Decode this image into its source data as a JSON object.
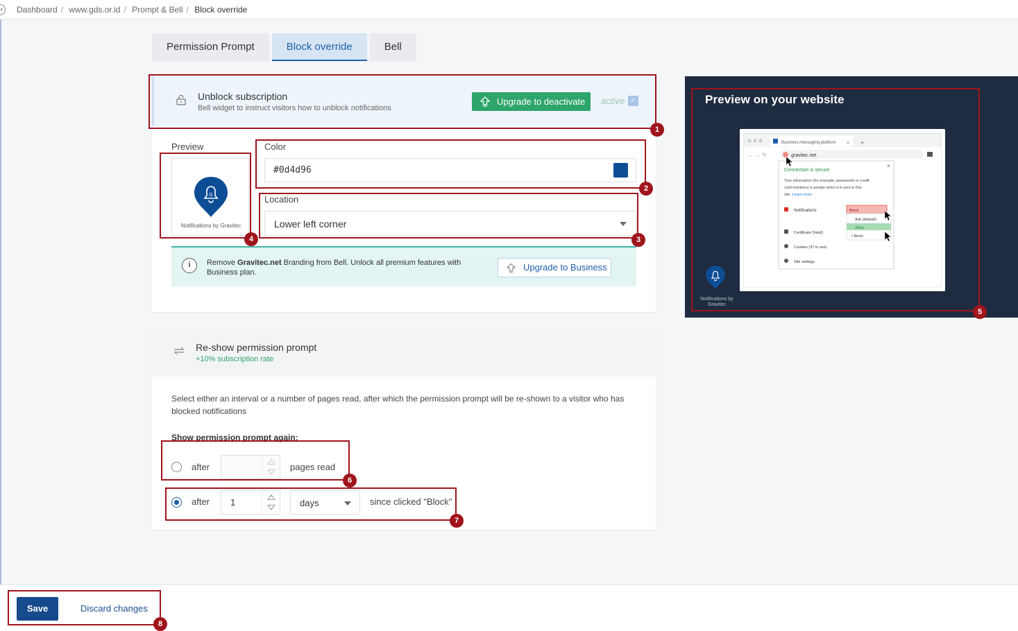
{
  "breadcrumb": [
    "Dashboard",
    "www.gds.or.id",
    "Prompt & Bell",
    "Block override"
  ],
  "tabs": [
    {
      "label": "Permission Prompt",
      "active": false
    },
    {
      "label": "Block override",
      "active": true
    },
    {
      "label": "Bell",
      "active": false
    }
  ],
  "unblock": {
    "title": "Unblock subscription",
    "subtitle": "Bell widget to instruct visitors how to unblock notifications",
    "upgrade_label": "Upgrade to deactivate",
    "active_label": "active",
    "active_checked": true,
    "preview_label": "Preview",
    "preview_caption": "Notifications by Gravitec",
    "color_label": "Color",
    "color_value": "#0d4d96",
    "location_label": "Location",
    "location_value": "Lower left corner",
    "promo": {
      "prefix": "Remove ",
      "brand": "Gravitec.net",
      "suffix": " Branding from Bell. Unlock all premium features with Business plan.",
      "button_label": "Upgrade to Business"
    }
  },
  "reshow": {
    "title": "Re-show permission prompt",
    "rate": "+10% subscription rate",
    "description": "Select either an interval or a number of pages read, after which the permission prompt will be re-shown to a visitor who has blocked notifications",
    "again_label": "Show permission prompt again:",
    "option_pages": {
      "selected": false,
      "prefix": "after",
      "value": "",
      "suffix": "pages read"
    },
    "option_days": {
      "selected": true,
      "prefix": "after",
      "value": "1",
      "unit": "days",
      "suffix": "since clicked \"Block\""
    }
  },
  "preview_panel": {
    "title": "Preview on your website",
    "caption": "Notifications by Gravitec",
    "browser": {
      "tab_title": "Business messaging platform",
      "url": "gravitec.net",
      "secure_title": "Connection is secure",
      "secure_text": "Your information (for example, passwords or credit card numbers) is private when it is sent to this site.",
      "learn_more": "Learn more",
      "notifications_label": "Notifications",
      "notifications_value": "Block",
      "options": [
        "Ask (default)",
        "Allow",
        "Block"
      ],
      "certificate": "Certificate (Valid)",
      "cookies": "Cookies (37 in use)",
      "site_settings": "Site settings"
    }
  },
  "footer": {
    "save_label": "Save",
    "discard_label": "Discard changes"
  },
  "callouts": [
    "1",
    "2",
    "3",
    "4",
    "5",
    "6",
    "7",
    "8"
  ],
  "colors": {
    "accent": "#1e5faa",
    "brand_blue": "#0d4d96",
    "success": "#2ea56a",
    "callout": "#a0141c",
    "panel_bg": "#1e2b40"
  }
}
